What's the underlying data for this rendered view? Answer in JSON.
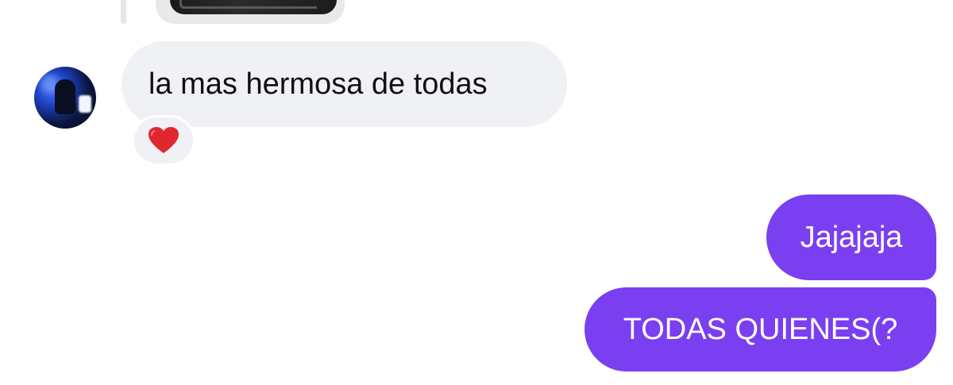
{
  "conversation": {
    "messages": [
      {
        "direction": "incoming",
        "text": "la mas hermosa de todas",
        "reaction": "heart-emoji",
        "bubble_color": "#eff1f4"
      },
      {
        "direction": "outgoing",
        "text": "Jajajaja",
        "bubble_color": "#7a3ff0"
      },
      {
        "direction": "outgoing",
        "text": "TODAS QUIENES(?",
        "bubble_color": "#7a3ff0"
      }
    ]
  },
  "colors": {
    "incoming_bubble": "#eff1f4",
    "outgoing_bubble": "#7a3ff0",
    "incoming_text": "#111111",
    "outgoing_text": "#ffffff",
    "reaction_heart": "#e0262e"
  }
}
